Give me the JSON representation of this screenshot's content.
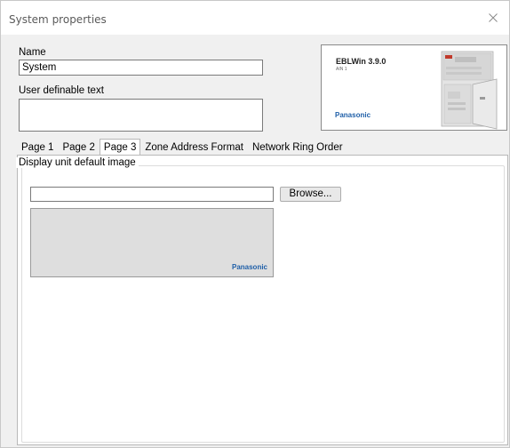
{
  "window": {
    "title": "System properties"
  },
  "form": {
    "name_label": "Name",
    "name_value": "System",
    "user_text_label": "User definable text",
    "user_text_value": ""
  },
  "banner": {
    "product": "EBLWin 3.9.0",
    "sub": "AIN 1",
    "brand": "Panasonic"
  },
  "tabs": [
    {
      "label": "Page 1",
      "active": false
    },
    {
      "label": "Page 2",
      "active": false
    },
    {
      "label": "Page 3",
      "active": true
    },
    {
      "label": "Zone Address Format",
      "active": false
    },
    {
      "label": "Network Ring Order",
      "active": false
    }
  ],
  "page3": {
    "group_title": "Display unit default image",
    "image_path": "",
    "browse_label": "Browse...",
    "preview_brand": "Panasonic"
  },
  "colors": {
    "brand_blue": "#1f5fa8",
    "window_bg": "#f0f0f0"
  }
}
